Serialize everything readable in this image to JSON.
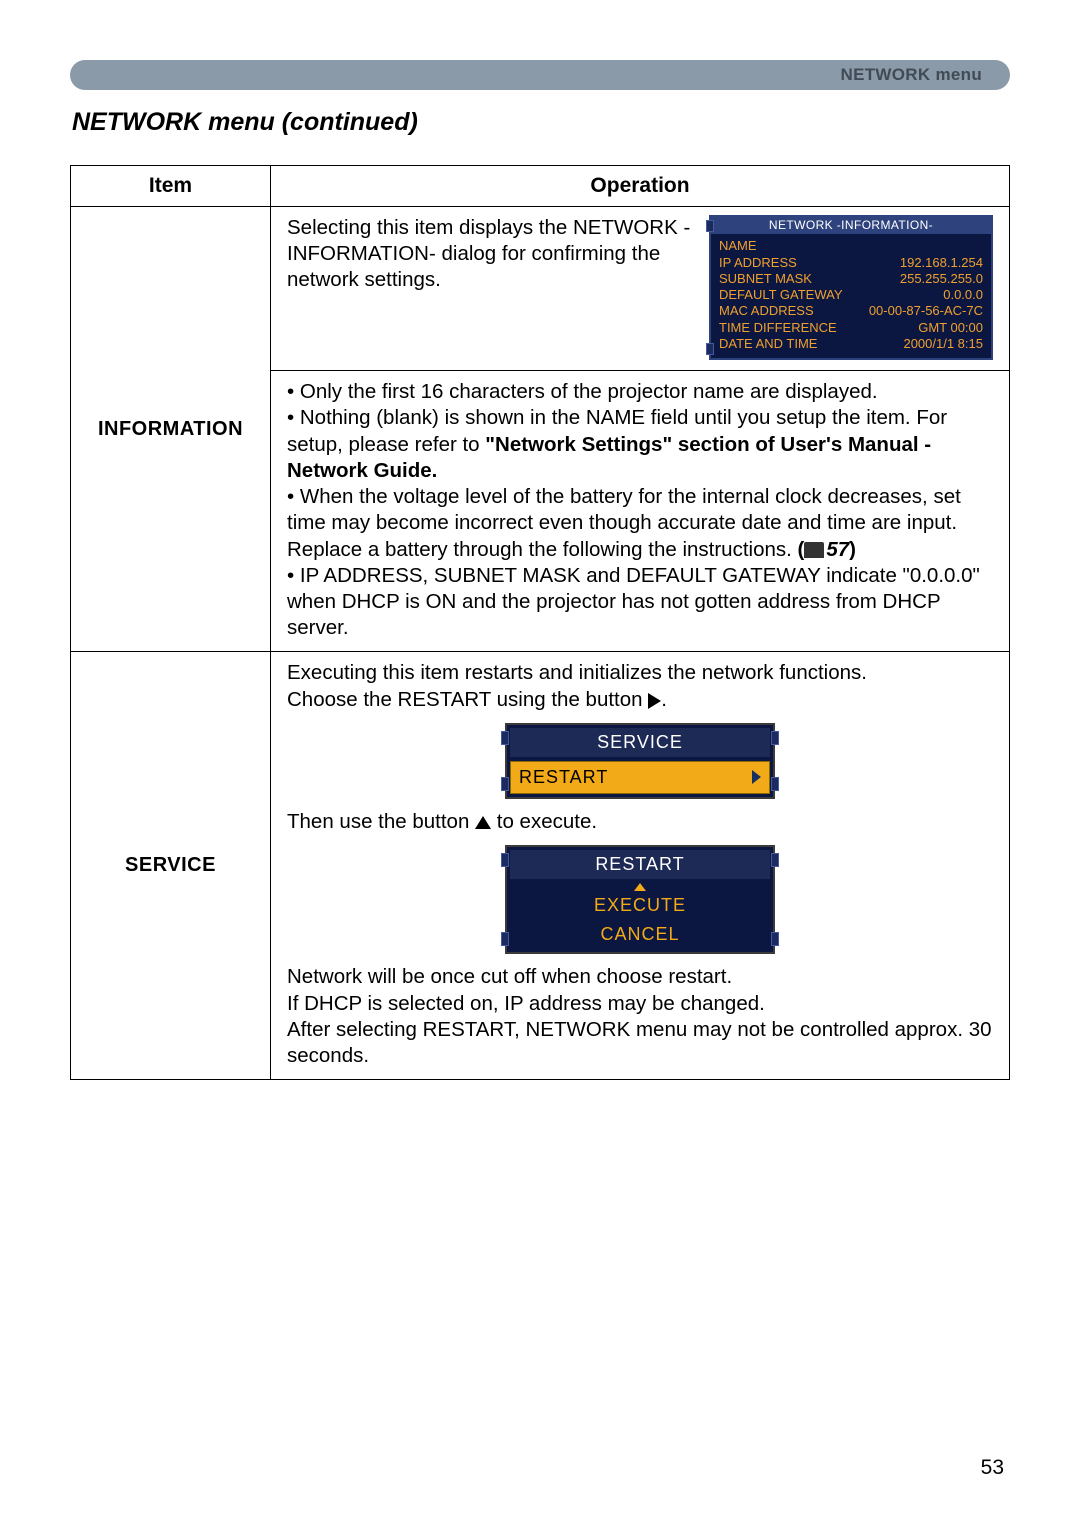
{
  "header": {
    "label": "NETWORK menu"
  },
  "section_title": "NETWORK menu (continued)",
  "table": {
    "col1": "Item",
    "col2": "Operation",
    "row_info": {
      "item": "INFORMATION",
      "intro": "Selecting this item displays the NETWORK -INFORMATION- dialog for confirming the network settings.",
      "dialog": {
        "title": "NETWORK -INFORMATION-",
        "rows": [
          {
            "k": "NAME",
            "v": ""
          },
          {
            "k": "IP ADDRESS",
            "v": "192.168.1.254"
          },
          {
            "k": "SUBNET MASK",
            "v": "255.255.255.0"
          },
          {
            "k": "DEFAULT GATEWAY",
            "v": "0.0.0.0"
          },
          {
            "k": "MAC ADDRESS",
            "v": "00-00-87-56-AC-7C"
          },
          {
            "k": "TIME DIFFERENCE",
            "v": "GMT 00:00"
          },
          {
            "k": "DATE AND TIME",
            "v": "2000/1/1 8:15"
          }
        ]
      },
      "bullets": {
        "b1a": "• Only the first 16 characters of the projector name are displayed.",
        "b2a": "• Nothing (blank) is shown in the NAME field until you setup the item. For setup, please refer to ",
        "b2bold": "\"Network Settings\" section of User's Manual - Network Guide.",
        "b3a": "• When the voltage level of the battery for the internal clock decreases, set time may become incorrect even though accurate date and time are input. Replace a battery through the following the instructions. ",
        "b3ref": "57",
        "b4a": "• IP ADDRESS, SUBNET MASK and DEFAULT GATEWAY indicate \"0.0.0.0\" when DHCP is ON and the projector has not gotten address from DHCP server."
      }
    },
    "row_svc": {
      "item": "SERVICE",
      "p1a": "Executing this item restarts and initializes the network functions.",
      "p1b": "Choose the RESTART using the button ",
      "p1c": ".",
      "menu1": {
        "title": "SERVICE",
        "option": "RESTART"
      },
      "p2a": "Then use the button ",
      "p2b": " to execute.",
      "menu2": {
        "title": "RESTART",
        "o1": "EXECUTE",
        "o2": "CANCEL"
      },
      "p3a": "Network will be once cut off when choose restart.",
      "p3b": "If DHCP is selected on, IP address may be changed.",
      "p3c": "After selecting RESTART, NETWORK menu may not be controlled approx. 30 seconds."
    }
  },
  "page_number": "53"
}
